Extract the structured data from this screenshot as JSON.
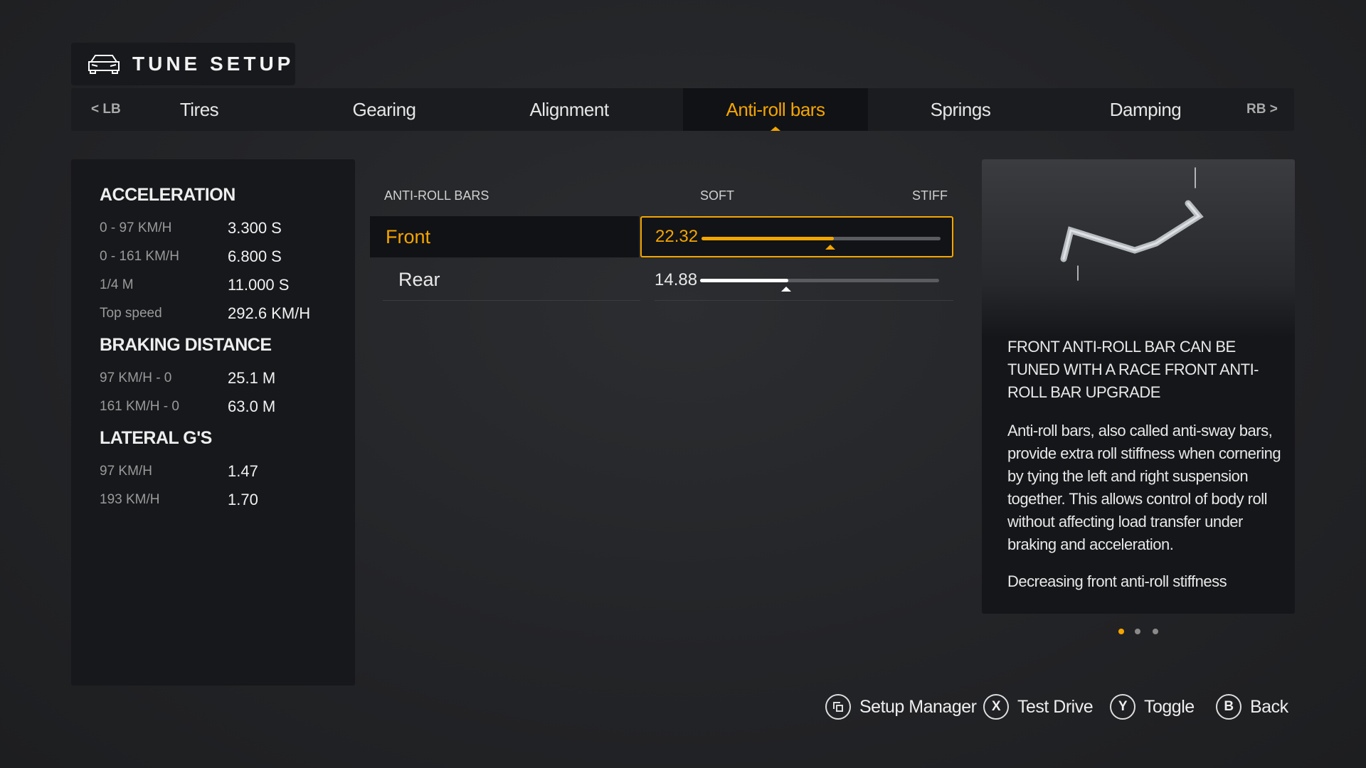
{
  "header": {
    "title": "TUNE SETUP",
    "icon": "car-icon"
  },
  "tabs": {
    "left_bumper": "< LB",
    "right_bumper": "RB >",
    "items": [
      {
        "label": "Tires"
      },
      {
        "label": "Gearing"
      },
      {
        "label": "Alignment"
      },
      {
        "label": "Anti-roll bars",
        "active": true
      },
      {
        "label": "Springs"
      },
      {
        "label": "Damping"
      }
    ]
  },
  "stats": {
    "acceleration": {
      "title": "ACCELERATION",
      "rows": [
        {
          "k": "0 - 97 KM/H",
          "v": "3.300 S"
        },
        {
          "k": "0 - 161 KM/H",
          "v": "6.800 S"
        },
        {
          "k": "1/4 M",
          "v": "11.000 S"
        },
        {
          "k": "Top speed",
          "v": "292.6 KM/H"
        }
      ]
    },
    "braking": {
      "title": "BRAKING DISTANCE",
      "rows": [
        {
          "k": "97 KM/H - 0",
          "v": "25.1 M"
        },
        {
          "k": "161 KM/H - 0",
          "v": "63.0 M"
        }
      ]
    },
    "lateral": {
      "title": "LATERAL G'S",
      "rows": [
        {
          "k": "97 KM/H",
          "v": "1.47"
        },
        {
          "k": "193 KM/H",
          "v": "1.70"
        }
      ]
    }
  },
  "tuning": {
    "section": "ANTI-ROLL BARS",
    "soft": "SOFT",
    "stiff": "STIFF",
    "rows": [
      {
        "label": "Front",
        "value": "22.32",
        "fill_fraction": 0.555,
        "marker_fraction": 0.54,
        "selected": true
      },
      {
        "label": "Rear",
        "value": "14.88",
        "fill_fraction": 0.37,
        "marker_fraction": 0.36,
        "selected": false
      }
    ]
  },
  "info": {
    "heading": "FRONT ANTI-ROLL BAR CAN BE TUNED WITH A RACE FRONT ANTI-ROLL BAR UPGRADE",
    "body": "Anti-roll bars, also called anti-sway bars, provide extra roll stiffness when cornering by tying the left and right suspension together. This allows control of body roll without affecting load transfer under braking and acceleration.",
    "body2": "Decreasing front anti-roll stiffness",
    "page": 1,
    "pages": 3
  },
  "footer": [
    {
      "key": "",
      "icon": "setup-manager-icon",
      "label": "Setup Manager"
    },
    {
      "key": "X",
      "label": "Test Drive"
    },
    {
      "key": "Y",
      "label": "Toggle"
    },
    {
      "key": "B",
      "label": "Back"
    }
  ],
  "colors": {
    "accent": "#f5a500",
    "panel": "#16181b"
  }
}
